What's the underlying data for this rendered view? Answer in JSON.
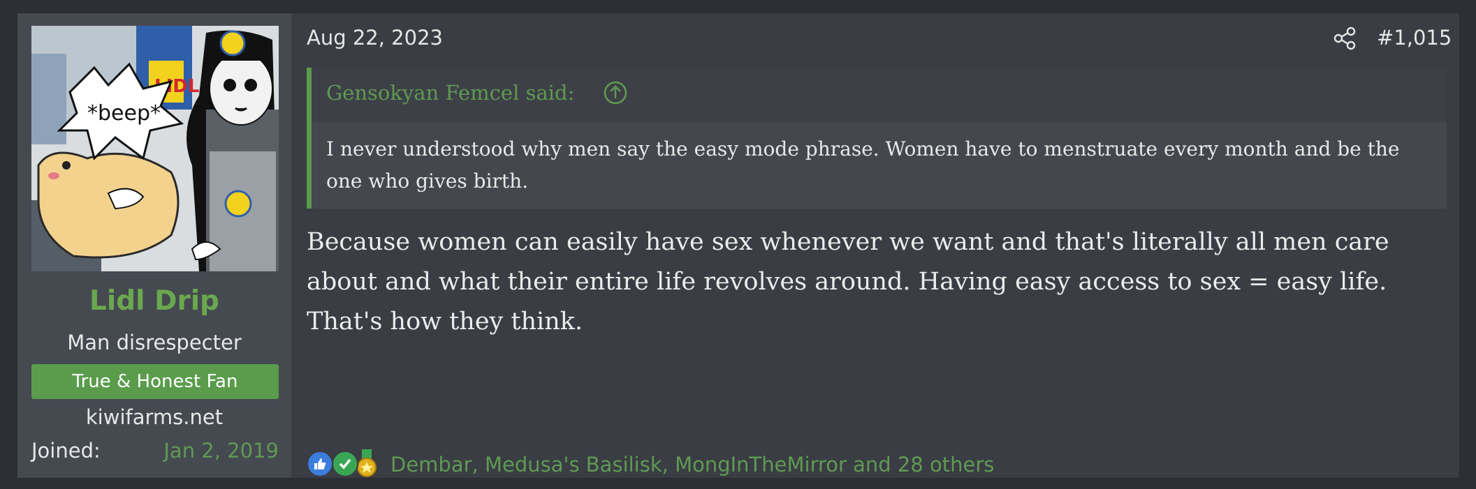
{
  "user": {
    "name": "Lidl Drip",
    "title": "Man disrespecter",
    "banner": "True & Honest Fan",
    "site": "kiwifarms.net",
    "joined_label": "Joined:",
    "joined_date": "Jan 2, 2019",
    "avatar_caption": "*beep*",
    "avatar_logo": "LIDL"
  },
  "post": {
    "date": "Aug 22, 2023",
    "number": "#1,015",
    "quote": {
      "author": "Gensokyan Femcel said:",
      "text": "I never understood why men say the easy mode phrase. Women have to menstruate every month and be the one who gives birth."
    },
    "body": "Because women can easily have sex whenever we want and that's literally all men care about and what their entire life revolves around. Having easy access to sex = easy life. That's how they think.",
    "reactions": {
      "icons": [
        "like-icon",
        "agree-icon",
        "medal-icon"
      ],
      "text": "Dembar, Medusa's Basilisk, MongInTheMirror and 28 others"
    }
  },
  "colors": {
    "accent": "#5a9c4b",
    "link": "#5f9a52",
    "background": "#3a3d44",
    "sidebar": "#454950"
  }
}
